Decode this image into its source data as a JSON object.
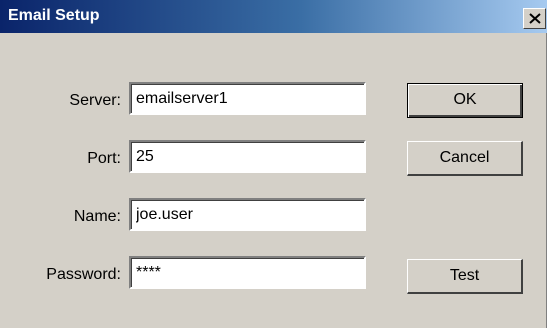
{
  "window": {
    "title": "Email Setup",
    "close_glyph": "×"
  },
  "form": {
    "server": {
      "label": "Server:",
      "value": "emailserver1"
    },
    "port": {
      "label": "Port:",
      "value": "25"
    },
    "name": {
      "label": "Name:",
      "value": "joe.user"
    },
    "password": {
      "label": "Password:",
      "value": "****"
    }
  },
  "buttons": {
    "ok": "OK",
    "cancel": "Cancel",
    "test": "Test"
  },
  "icons": {
    "close": "close-icon"
  }
}
